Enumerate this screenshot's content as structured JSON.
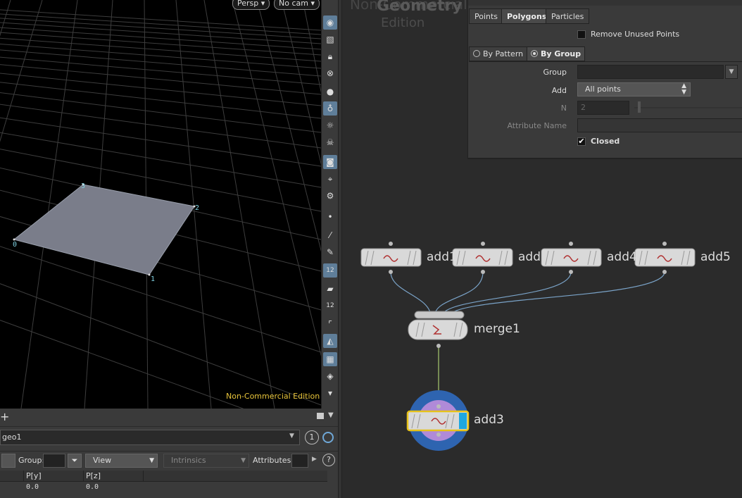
{
  "viewport": {
    "persp_label": "Persp ▾",
    "cam_label": "No cam ▾",
    "point_labels": [
      "0",
      "1",
      "2",
      "3"
    ],
    "watermark": "Non-Commercial Edition",
    "toolbar_icons": [
      "eye-icon",
      "select-icon",
      "lock-icon",
      "snap-icon",
      "sphere-icon",
      "light-icon",
      "bulb-icon",
      "skull-icon",
      "camera-icon",
      "display-icon",
      "render-icon",
      "point-icon",
      "brush-icon",
      "dropper-icon",
      "point-number-icon",
      "paint-icon",
      "prim-number-icon",
      "corner-icon",
      "transform-icon",
      "checker-icon",
      "layers-icon",
      "more-icon"
    ]
  },
  "bottom_left": {
    "add_label": "+",
    "path_value": "geo1",
    "page_number": "1",
    "group_label": "Group:",
    "view_combo": "View",
    "intrinsics_combo": "Intrinsics",
    "attributes_label": "Attributes:",
    "columns": [
      "P[y]",
      "P[z]"
    ],
    "row": [
      "0.0",
      "0.0"
    ]
  },
  "network": {
    "watermark_top": "Non-Commercial",
    "watermark_product": "Geometry",
    "watermark_edition": "Edition",
    "nodes": [
      {
        "name": "add1"
      },
      {
        "name": "add"
      },
      {
        "name": "add4"
      },
      {
        "name": "add5"
      },
      {
        "name": "merge1"
      },
      {
        "name": "add3"
      }
    ]
  },
  "params": {
    "tabs": [
      "Points",
      "Polygons",
      "Particles"
    ],
    "active_tab": "Polygons",
    "remove_unused_label": "Remove Unused Points",
    "subtabs": [
      "By Pattern",
      "By Group"
    ],
    "group_label": "Group",
    "add_label": "Add",
    "add_value": "All points",
    "n_label": "N",
    "n_value": "2",
    "attribute_name_label": "Attribute Name",
    "closed_label": "Closed",
    "closed_checked": true
  },
  "colors": {
    "selected_outline": "#e6c21a",
    "display_flag": "#1ea7e0",
    "wire": "#7aa3c8",
    "wire_selected": "#a9c970"
  }
}
